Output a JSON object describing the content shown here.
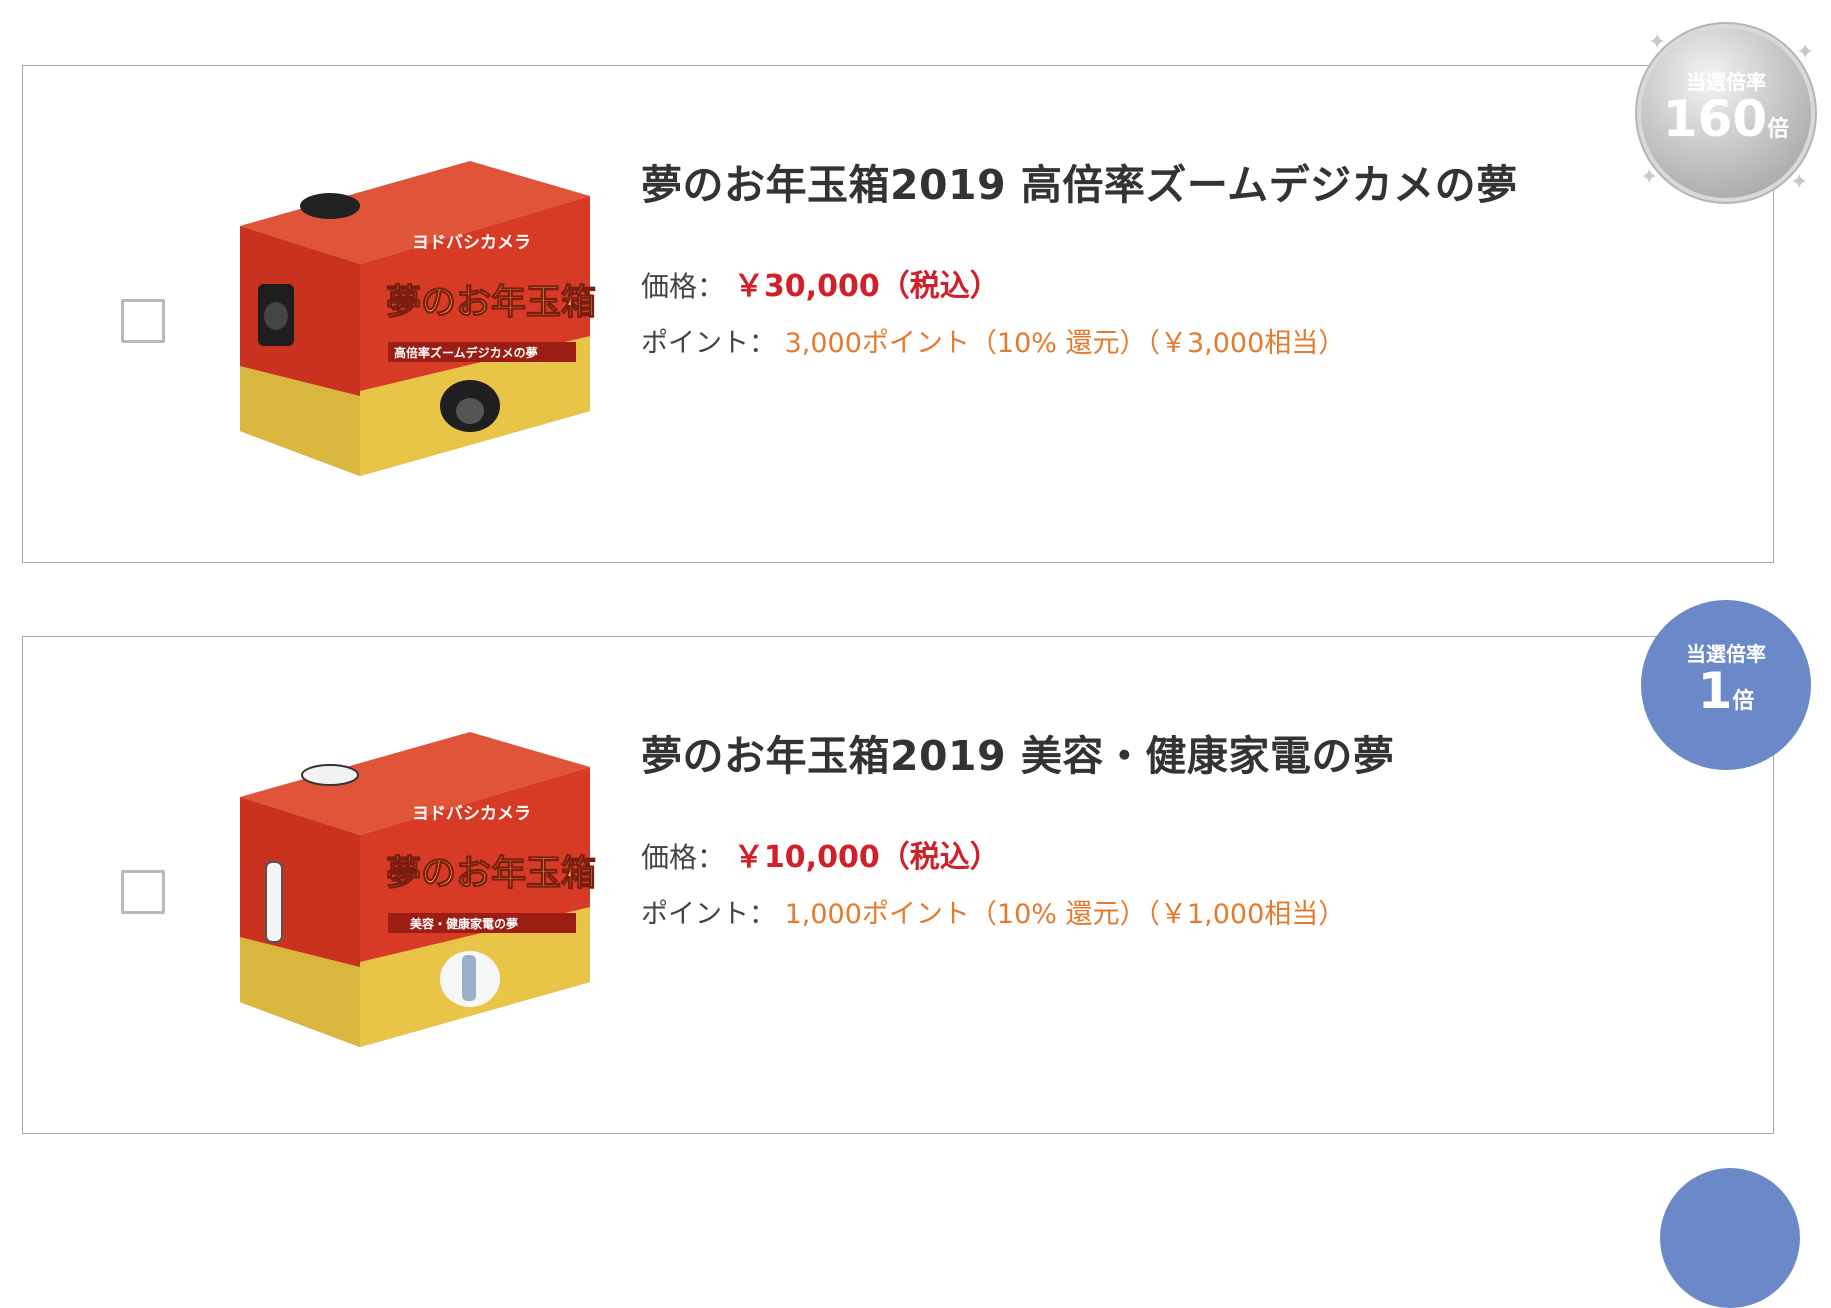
{
  "products": [
    {
      "title": "夢のお年玉箱2019 高倍率ズームデジカメの夢",
      "price_label": "価格：",
      "price_value": "￥30,000（税込）",
      "point_label": "ポイント：",
      "point_value": "3,000ポイント（10% 還元）（￥3,000相当）",
      "badge_label": "当選倍率",
      "badge_number": "160",
      "badge_unit": "倍",
      "box_brand": "ヨドバシカメラ",
      "box_title": "夢のお年玉箱",
      "box_sub": "高倍率ズームデジカメの夢"
    },
    {
      "title": "夢のお年玉箱2019 美容・健康家電の夢",
      "price_label": "価格：",
      "price_value": "￥10,000（税込）",
      "point_label": "ポイント：",
      "point_value": "1,000ポイント（10% 還元）（￥1,000相当）",
      "badge_label": "当選倍率",
      "badge_number": "1",
      "badge_unit": "倍",
      "box_brand": "ヨドバシカメラ",
      "box_title": "夢のお年玉箱",
      "box_sub": "美容・健康家電の夢"
    }
  ],
  "colors": {
    "price": "#d0202a",
    "point": "#e57a2c",
    "badge_blue": "#6b89c8",
    "box_red": "#d23a24",
    "box_gold": "#e8c547"
  }
}
